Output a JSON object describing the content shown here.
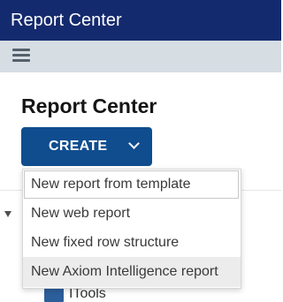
{
  "header": {
    "title": "Report Center"
  },
  "toolbar": {
    "menu_icon": "hamburger-menu-icon"
  },
  "main": {
    "heading": "Report Center",
    "create_label": "CREATE",
    "create_icon": "chevron-down-icon"
  },
  "menu": {
    "items": [
      {
        "label": "New report from template"
      },
      {
        "label": "New web report"
      },
      {
        "label": "New fixed row structure"
      },
      {
        "label": "New Axiom Intelligence report"
      }
    ]
  },
  "tree": {
    "visible_label": "ITools"
  },
  "colors": {
    "header": "#142a6e",
    "toolbar": "#d6dde3",
    "button": "#0f4d8f",
    "folder": "#2c5e9a"
  }
}
